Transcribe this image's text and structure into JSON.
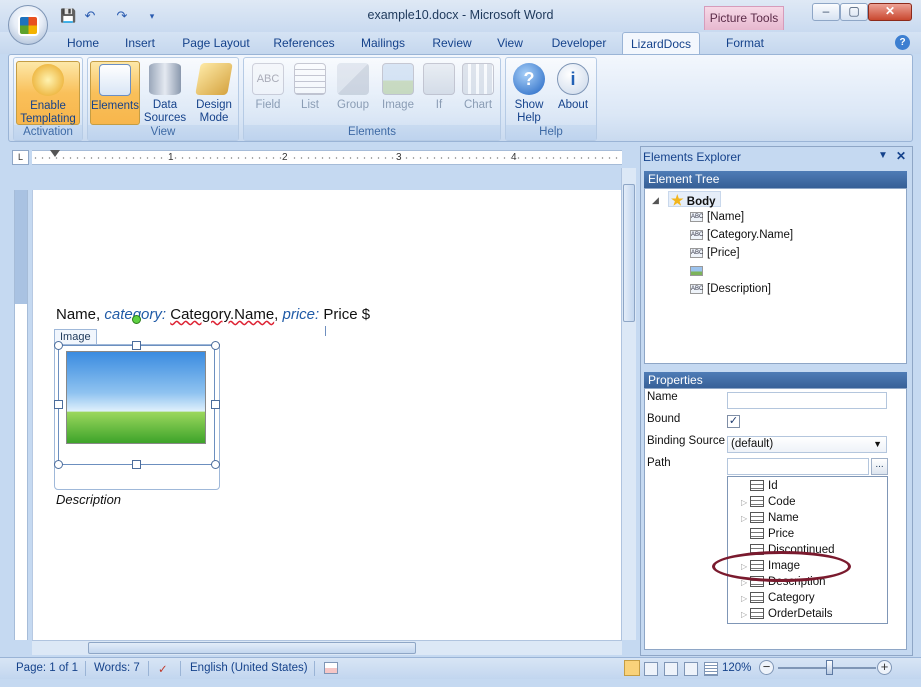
{
  "window": {
    "title": "example10.docx - Microsoft Word",
    "context_tab_group": "Picture Tools",
    "controls": {
      "minimize": "‒",
      "restore": "▢",
      "close": "✕"
    }
  },
  "quick_access": {
    "save": "💾",
    "undo": "↶",
    "redo": "↷",
    "customize": "▾"
  },
  "tabs": [
    "Home",
    "Insert",
    "Page Layout",
    "References",
    "Mailings",
    "Review",
    "View",
    "Developer",
    "LizardDocs",
    "Format"
  ],
  "active_tab": "LizardDocs",
  "ribbon": {
    "groups": [
      {
        "label": "Activation",
        "buttons": [
          {
            "label": "Enable Templating",
            "icon": "lizard-icon"
          }
        ]
      },
      {
        "label": "View",
        "buttons": [
          {
            "label": "Elements",
            "icon": "elements-tree-icon"
          },
          {
            "label": "Data Sources",
            "icon": "database-icon"
          },
          {
            "label": "Design Mode",
            "icon": "design-ruler-icon"
          }
        ]
      },
      {
        "label": "Elements",
        "buttons": [
          {
            "label": "Field",
            "icon": "abc-field-icon"
          },
          {
            "label": "List",
            "icon": "list-icon"
          },
          {
            "label": "Group",
            "icon": "group-icon"
          },
          {
            "label": "Image",
            "icon": "image-icon"
          },
          {
            "label": "If",
            "icon": "if-icon"
          },
          {
            "label": "Chart",
            "icon": "chart-icon"
          }
        ]
      },
      {
        "label": "Help",
        "buttons": [
          {
            "label": "Show Help",
            "icon": "help-circle-icon"
          },
          {
            "label": "About",
            "icon": "info-icon"
          }
        ]
      }
    ]
  },
  "ruler": {
    "numbers": [
      "1",
      "2",
      "3",
      "4"
    ],
    "tab_marker": "L"
  },
  "document": {
    "line_parts": [
      {
        "text": "Name, ",
        "style": "plain"
      },
      {
        "text": "category:",
        "style": "field"
      },
      {
        "text": " ",
        "style": "plain"
      },
      {
        "text": "Category.Name",
        "style": "squiggle"
      },
      {
        "text": ", ",
        "style": "plain"
      },
      {
        "text": "price:",
        "style": "field"
      },
      {
        "text": " Price $",
        "style": "plain"
      }
    ],
    "image_tag": "Image",
    "description": "Description"
  },
  "elements_explorer": {
    "title": "Elements Explorer",
    "tree_header": "Element Tree",
    "root": "Body",
    "nodes": [
      "[Name]",
      "[Category.Name]",
      "[Price]",
      "",
      "[Description]"
    ],
    "properties_header": "Properties",
    "properties": {
      "name_label": "Name",
      "name_value": "",
      "bound_label": "Bound",
      "bound_checked": true,
      "bound_check": "✓",
      "binding_source_label": "Binding Source",
      "binding_source_value": "(default)",
      "path_label": "Path",
      "path_value": "",
      "browse": "..."
    },
    "path_options": [
      {
        "label": "Id",
        "expandable": false
      },
      {
        "label": "Code",
        "expandable": true
      },
      {
        "label": "Name",
        "expandable": true
      },
      {
        "label": "Price",
        "expandable": false
      },
      {
        "label": "Discontinued",
        "expandable": false
      },
      {
        "label": "Image",
        "expandable": true
      },
      {
        "label": "Description",
        "expandable": true
      },
      {
        "label": "Category",
        "expandable": true
      },
      {
        "label": "OrderDetails",
        "expandable": true
      }
    ],
    "highlighted_option": "Image"
  },
  "status_bar": {
    "page": "Page: 1 of 1",
    "words": "Words: 7",
    "language": "English (United States)",
    "zoom": "120%",
    "zoom_level_percent": 120
  },
  "colors": {
    "accent": "#15428b",
    "highlight_ring": "#7a1a2e",
    "active_button": "#f9c05a"
  }
}
